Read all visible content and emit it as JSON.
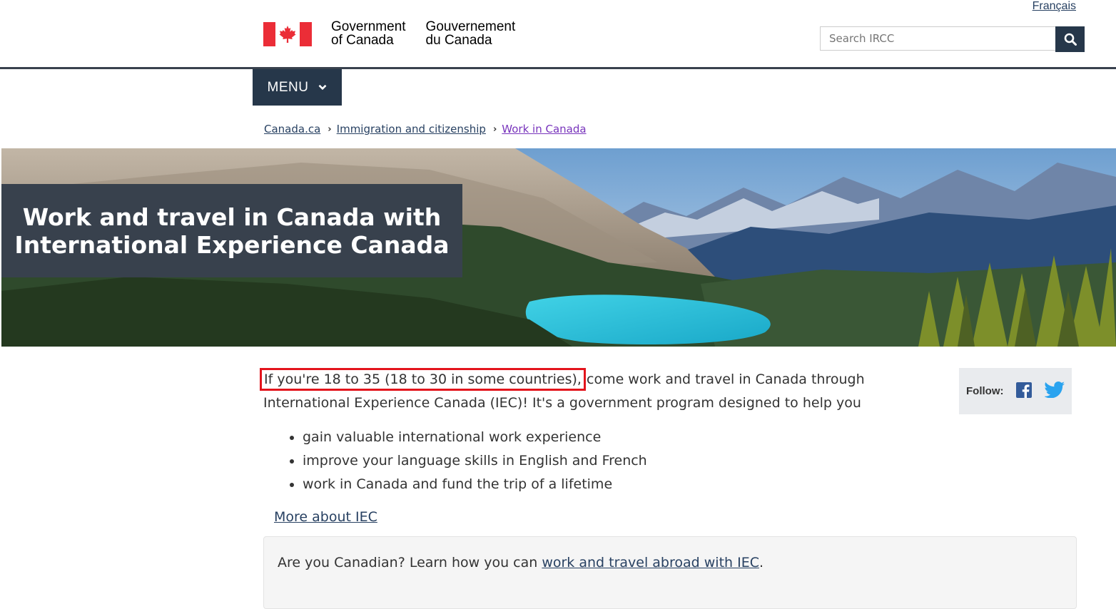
{
  "header": {
    "language_toggle": "Français",
    "signature_en_line1": "Government",
    "signature_en_line2": "of Canada",
    "signature_fr_line1": "Gouvernement",
    "signature_fr_line2": "du Canada",
    "search_placeholder": "Search IRCC",
    "search_icon": "search-icon",
    "colors": {
      "flag_red": "#eb2d37",
      "nav_dark": "#26374a",
      "link": "#284162",
      "visited": "#7834bc"
    }
  },
  "menu": {
    "label": "MENU",
    "icon": "chevron-down-icon"
  },
  "breadcrumb": {
    "items": [
      {
        "label": "Canada.ca"
      },
      {
        "label": "Immigration and citizenship"
      },
      {
        "label": "Work in Canada"
      }
    ]
  },
  "hero": {
    "title_line1": "Work and travel in Canada with",
    "title_line2": "International Experience Canada"
  },
  "main": {
    "intro_highlight": "If you're 18 to 35 (18 to 30 in some countries),",
    "intro_rest": " come work and travel in Canada through International Experience Canada (IEC)! It's a government program designed to help you",
    "bullets": [
      "gain valuable international work experience",
      "improve your language skills in English and French",
      "work in Canada and fund the trip of a lifetime"
    ],
    "more_link": "More about IEC",
    "well_text_before": "Are you Canadian? Learn how you can ",
    "well_link": "work and travel abroad with IEC",
    "well_text_after": "."
  },
  "follow": {
    "label": "Follow:",
    "icons": [
      "facebook-icon",
      "twitter-icon"
    ]
  }
}
